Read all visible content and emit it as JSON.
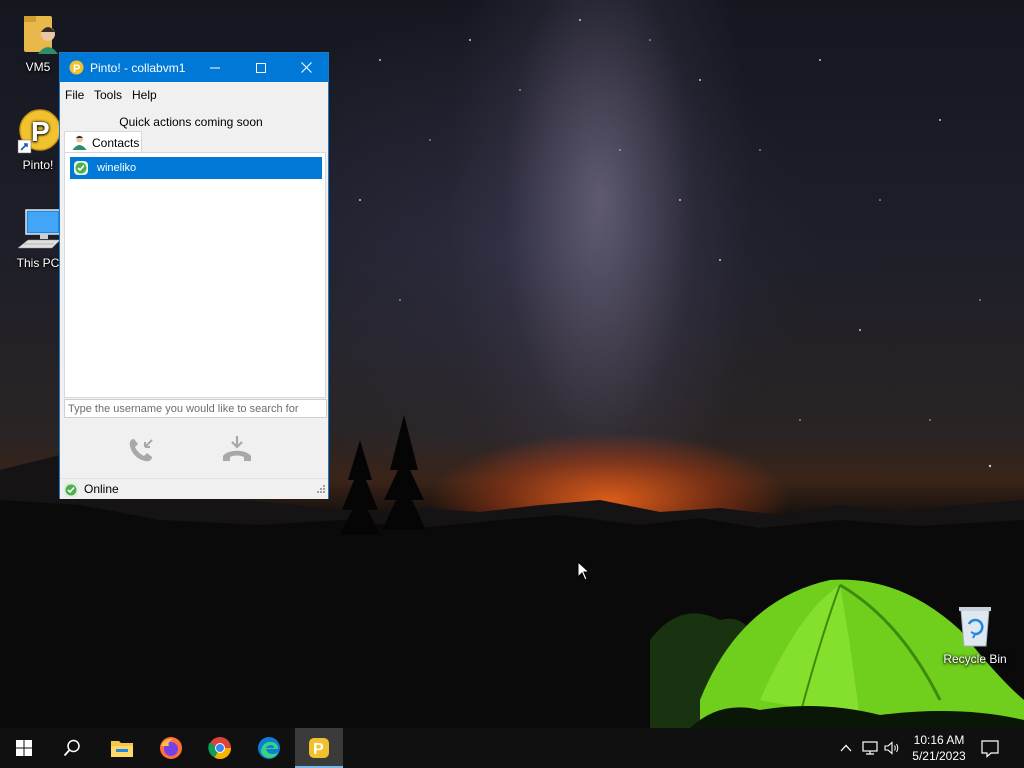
{
  "desktop": {
    "icons": [
      {
        "label": "VM5"
      },
      {
        "label": "Pinto!"
      },
      {
        "label": "This PC"
      },
      {
        "label": "Recycle Bin"
      }
    ]
  },
  "window": {
    "title": "Pinto! - collabvm1",
    "menu": [
      "File",
      "Tools",
      "Help"
    ],
    "quick_actions": "Quick actions coming soon",
    "tab_label": "Contacts",
    "contacts": [
      {
        "name": "wineliko",
        "selected": true
      }
    ],
    "search_placeholder": "Type the username you would like to search for",
    "status": "Online"
  },
  "taskbar": {
    "time": "10:16 AM",
    "date": "5/21/2023",
    "apps": [
      "start-icon",
      "search-icon",
      "file-explorer-icon",
      "firefox-icon",
      "chrome-icon",
      "edge-icon",
      "pinto-icon"
    ]
  },
  "colors": {
    "accent": "#0078d7",
    "taskbar": "#101010",
    "pinto_yellow": "#f2c12e",
    "online_green": "#4caf50"
  }
}
